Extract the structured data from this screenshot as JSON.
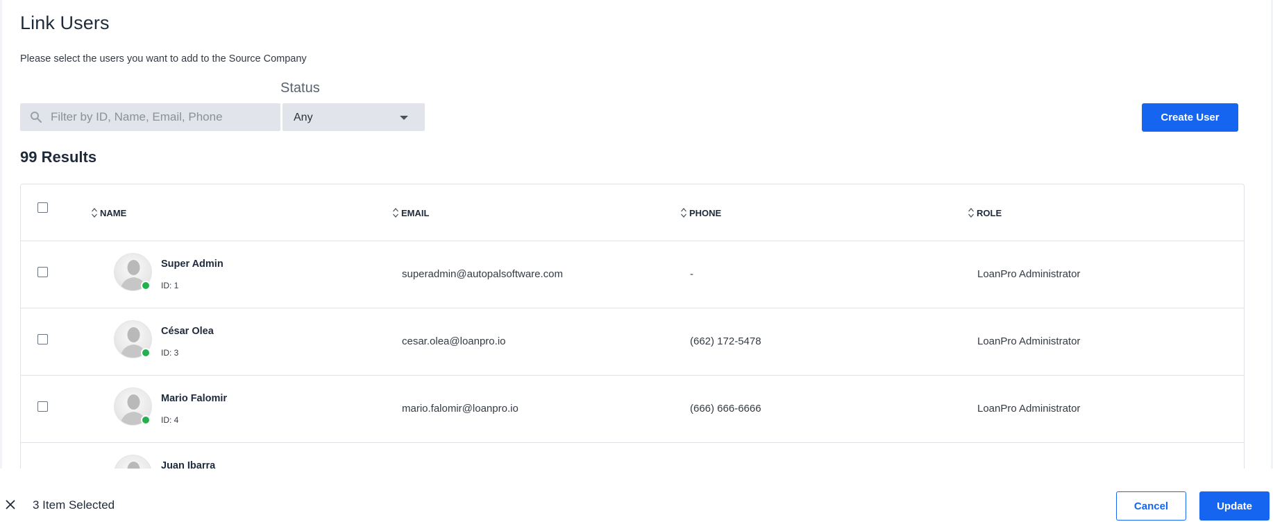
{
  "page": {
    "title": "Link Users",
    "subtitle": "Please select the users you want to add to the Source Company"
  },
  "filters": {
    "status_label": "Status",
    "search_placeholder": "Filter by ID, Name, Email, Phone",
    "status_value": "Any"
  },
  "actions": {
    "create_user_label": "Create User"
  },
  "results": {
    "count_label": "99 Results"
  },
  "table": {
    "columns": [
      "NAME",
      "EMAIL",
      "PHONE",
      "ROLE"
    ],
    "rows": [
      {
        "name": "Super Admin",
        "id": "ID: 1",
        "email": "superadmin@autopalsoftware.com",
        "phone": "-",
        "role": "LoanPro Administrator",
        "status_color": "#22b14c"
      },
      {
        "name": "César Olea",
        "id": "ID: 3",
        "email": "cesar.olea@loanpro.io",
        "phone": "(662) 172-5478",
        "role": "LoanPro Administrator",
        "status_color": "#22b14c"
      },
      {
        "name": "Mario Falomir",
        "id": "ID: 4",
        "email": "mario.falomir@loanpro.io",
        "phone": "(666) 666-6666",
        "role": "LoanPro Administrator",
        "status_color": "#22b14c"
      },
      {
        "name": "Juan Ibarra",
        "id": "",
        "email": "",
        "phone": "",
        "role": "",
        "status_color": "#22b14c"
      }
    ]
  },
  "selection_bar": {
    "selected_label": "3 Item Selected",
    "cancel_label": "Cancel",
    "update_label": "Update"
  },
  "colors": {
    "primary": "#1565f0",
    "online": "#22b14c"
  }
}
